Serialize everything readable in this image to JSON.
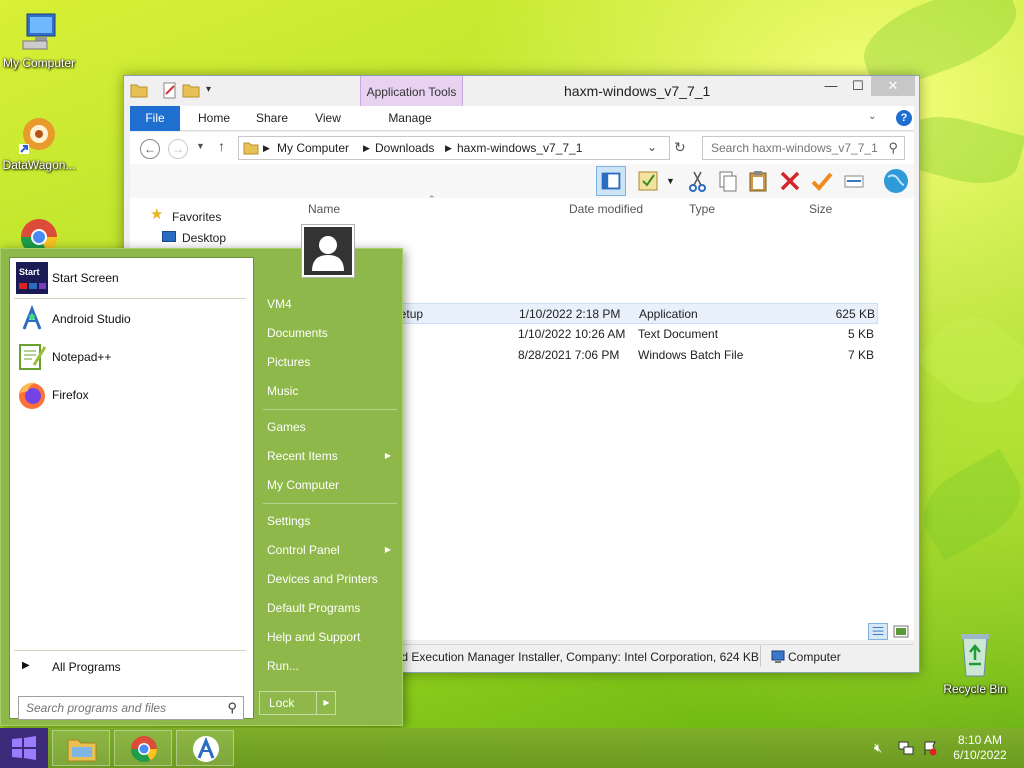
{
  "desktop": {
    "icons": [
      {
        "label": "My Computer"
      },
      {
        "label": "DataWagon..."
      },
      {
        "label": "Recycle Bin"
      }
    ]
  },
  "explorer": {
    "title": "haxm-windows_v7_7_1",
    "context_tab": "Application Tools",
    "tabs": [
      "File",
      "Home",
      "Share",
      "View",
      "Manage"
    ],
    "window_controls": {
      "minimize": "—",
      "maximize": "☐",
      "close": "✕"
    },
    "breadcrumb": [
      "My Computer",
      "Downloads",
      "haxm-windows_v7_7_1"
    ],
    "search_placeholder": "Search haxm-windows_v7_7_1",
    "nav_pane": {
      "favorites": "Favorites",
      "desktop": "Desktop"
    },
    "columns": [
      "Name",
      "Date modified",
      "Type",
      "Size"
    ],
    "files": [
      {
        "name": "-7.7.1-setup",
        "date": "1/10/2022 2:18 PM",
        "type": "Application",
        "size": "625 KB"
      },
      {
        "name": "",
        "date": "1/10/2022 10:26 AM",
        "type": "Text Document",
        "size": "5 KB"
      },
      {
        "name": "",
        "date": "8/28/2021 7:06 PM",
        "type": "Windows Batch File",
        "size": "7 KB"
      }
    ],
    "status": {
      "details": "Intel Hardware Accelerated Execution Manager Installer, Company: Intel Corporation, 624 KB",
      "location": "Computer"
    }
  },
  "start_menu": {
    "left": [
      {
        "label": "Start Screen"
      },
      {
        "label": "Android Studio"
      },
      {
        "label": "Notepad++"
      },
      {
        "label": "Firefox"
      }
    ],
    "start_tile_text": "Start",
    "all_programs": "All Programs",
    "search_placeholder": "Search programs and files",
    "right": [
      {
        "label": "VM4"
      },
      {
        "label": "Documents"
      },
      {
        "label": "Pictures"
      },
      {
        "label": "Music"
      },
      {
        "label": "Games"
      },
      {
        "label": "Recent Items",
        "arrow": true
      },
      {
        "label": "My Computer"
      },
      {
        "label": "Settings"
      },
      {
        "label": "Control Panel",
        "arrow": true
      },
      {
        "label": "Devices and Printers"
      },
      {
        "label": "Default Programs"
      },
      {
        "label": "Help and Support"
      },
      {
        "label": "Run..."
      }
    ],
    "lock_label": "Lock"
  },
  "taskbar": {
    "time": "8:10 AM",
    "date": "6/10/2022"
  },
  "colors": {
    "accent": "#1e6fd0",
    "start_green": "#8fb84a",
    "taskbar": "#7fae2b"
  }
}
